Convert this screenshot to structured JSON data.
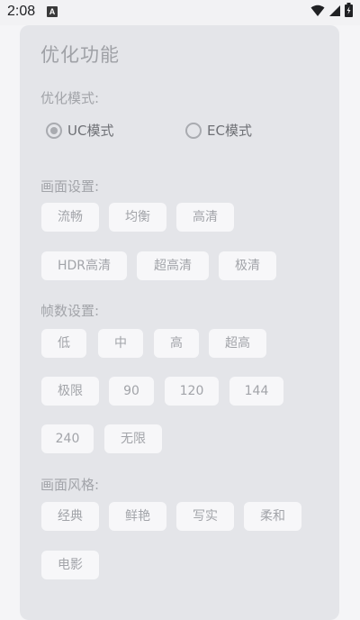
{
  "status_bar": {
    "time": "2:08",
    "notification_icon": "A",
    "icons": [
      "wifi-icon",
      "signal-icon",
      "battery-icon"
    ]
  },
  "panel": {
    "title": "优化功能"
  },
  "optimization_mode": {
    "label": "优化模式:",
    "options": [
      {
        "label": "UC模式",
        "selected": true
      },
      {
        "label": "EC模式",
        "selected": false
      }
    ]
  },
  "image_settings": {
    "label": "画面设置:",
    "options": [
      "流畅",
      "均衡",
      "高清",
      "HDR高清",
      "超高清",
      "极清"
    ]
  },
  "frame_settings": {
    "label": "帧数设置:",
    "options": [
      "低",
      "中",
      "高",
      "超高",
      "极限",
      "90",
      "120",
      "144",
      "240",
      "无限"
    ]
  },
  "image_style": {
    "label": "画面风格:",
    "options": [
      "经典",
      "鲜艳",
      "写实",
      "柔和",
      "电影"
    ]
  },
  "colors": {
    "card_bg": "#e4e5e9",
    "chip_bg": "#f7f7f9",
    "text_muted": "#a2a4a9"
  }
}
